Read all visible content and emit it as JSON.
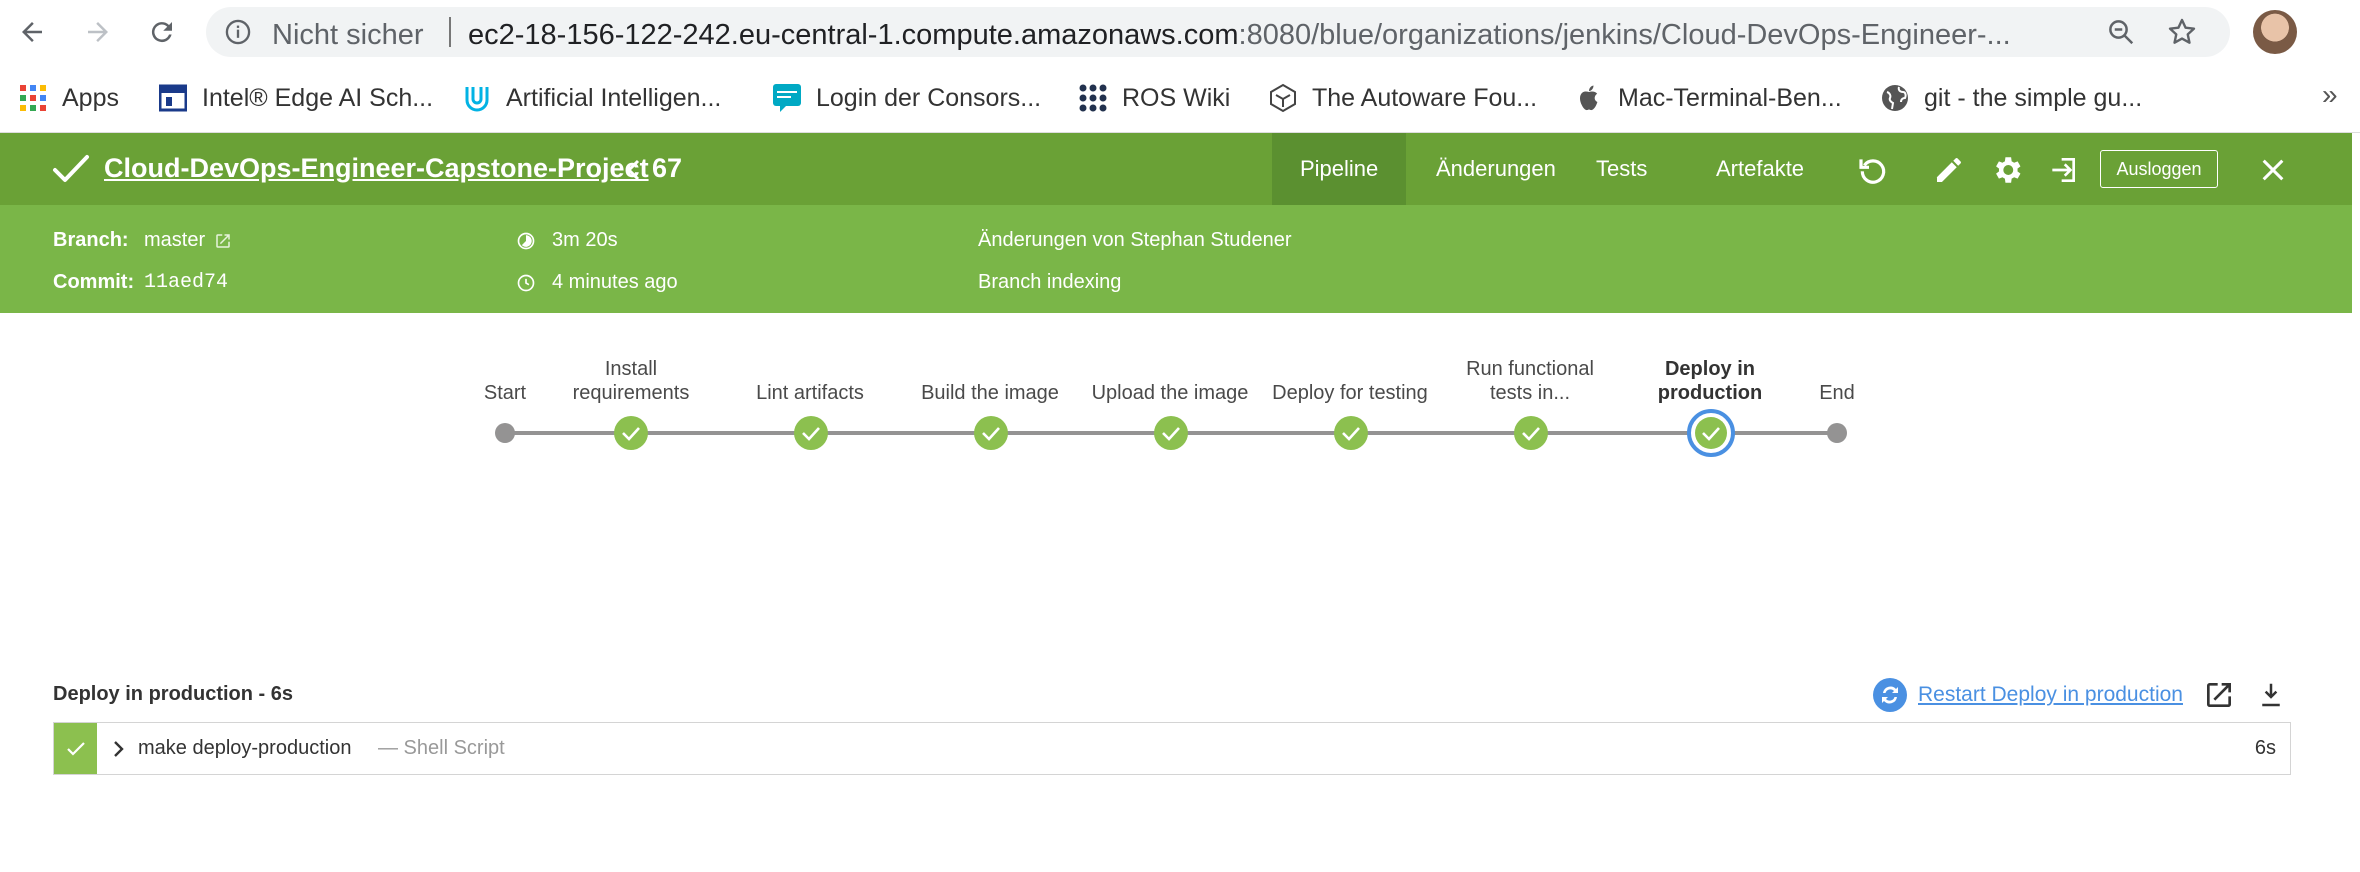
{
  "browser": {
    "insecure_label": "Nicht sicher",
    "url_host": "ec2-18-156-122-242.eu-central-1.compute.amazonaws.com",
    "url_rest": ":8080/blue/organizations/jenkins/Cloud-DevOps-Engineer-..."
  },
  "bookmarks": [
    {
      "label": "Apps",
      "icon": "apps-grid-icon"
    },
    {
      "label": "Intel® Edge AI Sch...",
      "icon": "intel-icon"
    },
    {
      "label": "Artificial Intelligen...",
      "icon": "udacity-icon"
    },
    {
      "label": "Login der Consors...",
      "icon": "consorsbank-icon"
    },
    {
      "label": "ROS Wiki",
      "icon": "ros-icon"
    },
    {
      "label": "The Autoware Fou...",
      "icon": "autoware-icon"
    },
    {
      "label": "Mac-Terminal-Ben...",
      "icon": "apple-icon"
    },
    {
      "label": "git - the simple gu...",
      "icon": "globe-icon"
    }
  ],
  "header": {
    "title": "Cloud-DevOps-Engineer-Capstone-Project",
    "run_number": "67",
    "tabs": [
      "Pipeline",
      "Änderungen",
      "Tests",
      "Artefakte"
    ],
    "active_tab": "Pipeline",
    "logout_label": "Ausloggen"
  },
  "run": {
    "branch_label": "Branch:",
    "branch_value": "master",
    "commit_label": "Commit:",
    "commit_value": "11aed74",
    "duration": "3m 20s",
    "started": "4 minutes ago",
    "changes": "Änderungen von Stephan Studener",
    "cause": "Branch indexing"
  },
  "pipeline": {
    "stages": [
      {
        "label": "Start",
        "status": "start"
      },
      {
        "label": "Install requirements",
        "status": "success"
      },
      {
        "label": "Lint artifacts",
        "status": "success"
      },
      {
        "label": "Build the image",
        "status": "success"
      },
      {
        "label": "Upload the image",
        "status": "success"
      },
      {
        "label": "Deploy for testing",
        "status": "success"
      },
      {
        "label": "Run functional tests in...",
        "status": "success"
      },
      {
        "label": "Deploy in production",
        "status": "success-selected"
      },
      {
        "label": "End",
        "status": "end"
      }
    ]
  },
  "step": {
    "title": "Deploy in production - 6s",
    "restart_label": "Restart Deploy in production",
    "rows": [
      {
        "name": "make deploy-production",
        "type": "— Shell Script",
        "duration": "6s"
      }
    ]
  },
  "colors": {
    "header_green": "#6aa136",
    "subheader_green": "#7ab648",
    "success_green": "#8cc04f",
    "selected_ring": "#4a90e2"
  }
}
